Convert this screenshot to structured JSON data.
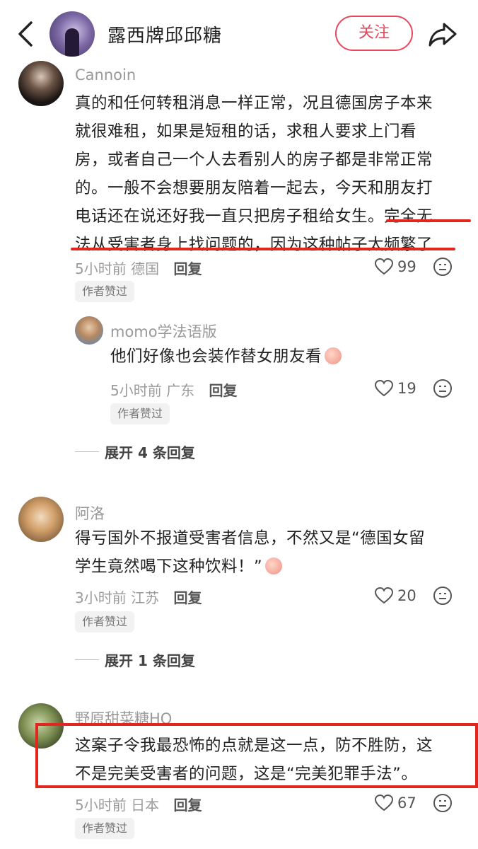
{
  "header": {
    "author_name": "露西牌邱邱糖",
    "follow_label": "关注"
  },
  "comments": [
    {
      "username": "Cannoin",
      "lines": [
        "真的和任何转租消息一样正常，况且德国房子本来",
        "就很难租，如果是短租的话，求租人要求上门看",
        "房，或者自己一个人去看别人的房子都是非常正常",
        "的。一般不会想要朋友陪着一起去，今天和朋友打",
        "电话还在说还好我一直只把房子租给女生。完全无",
        "法从受害者身上找问题的，因为这种帖子太频繁了..."
      ],
      "time": "5小时前",
      "location": "德国",
      "reply_label": "回复",
      "likes": "99",
      "badge": "作者赞过"
    },
    {
      "username": "momo学法语版",
      "text": "他们好像也会装作替女朋友看",
      "time": "5小时前",
      "location": "广东",
      "reply_label": "回复",
      "likes": "19",
      "badge": "作者赞过"
    },
    {
      "expand_label": "展开 4 条回复"
    },
    {
      "username": "阿洛",
      "lines": [
        "得亏国外不报道受害者信息，不然又是“德国女留",
        "学生竟然喝下这种饮料！”"
      ],
      "time": "3小时前",
      "location": "江苏",
      "reply_label": "回复",
      "likes": "20",
      "badge": "作者赞过"
    },
    {
      "expand_label": "展开 1 条回复"
    },
    {
      "username": "野原甜菜糖HQ",
      "lines": [
        "这案子令我最恐怖的点就是这一点，防不胜防，这",
        "不是完美受害者的问题，这是“完美犯罪手法”。"
      ],
      "time": "5小时前",
      "location": "日本",
      "reply_label": "回复",
      "likes": "67",
      "badge": "作者赞过"
    }
  ],
  "icons": {
    "back": "chevron-left-icon",
    "share": "share-arrow-icon",
    "like": "heart-outline-icon",
    "dislike": "neutral-face-icon"
  },
  "colors": {
    "accent": "#e8475c",
    "highlight": "#e0261e"
  }
}
